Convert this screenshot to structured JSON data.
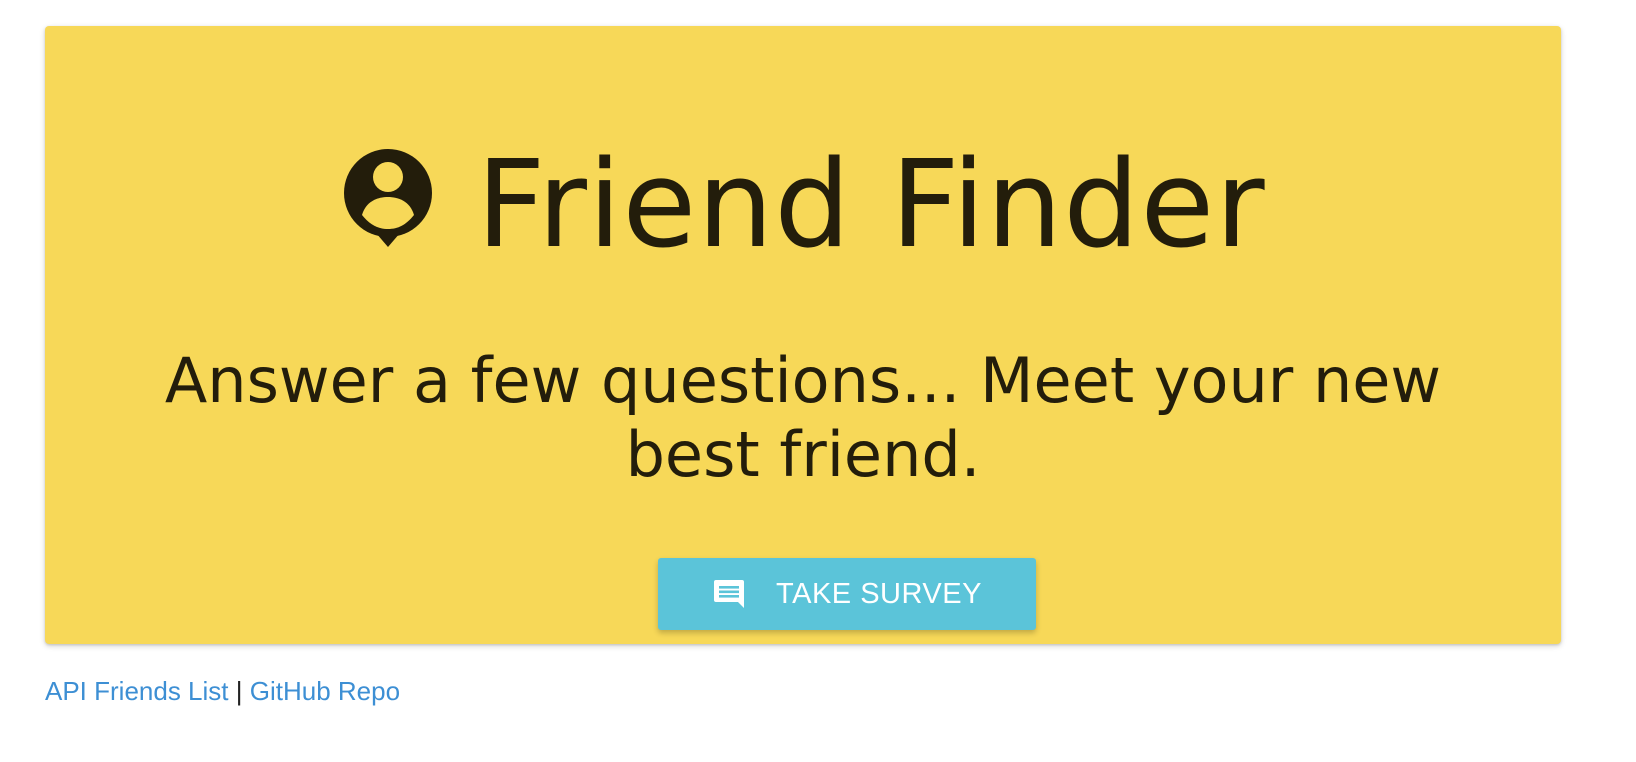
{
  "hero": {
    "title": "Friend Finder",
    "tagline": "Answer a few questions... Meet your new best friend.",
    "logo_icon": "person-pin-icon",
    "background_color": "#f7d858",
    "text_color": "#231d0b"
  },
  "survey_button": {
    "label": "TAKE SURVEY",
    "icon": "chat-icon",
    "color": "#5bc4d9"
  },
  "footer": {
    "api_link_label": "API Friends List",
    "separator": "|",
    "github_link_label": "GitHub Repo",
    "link_color": "#3d8fd4"
  }
}
